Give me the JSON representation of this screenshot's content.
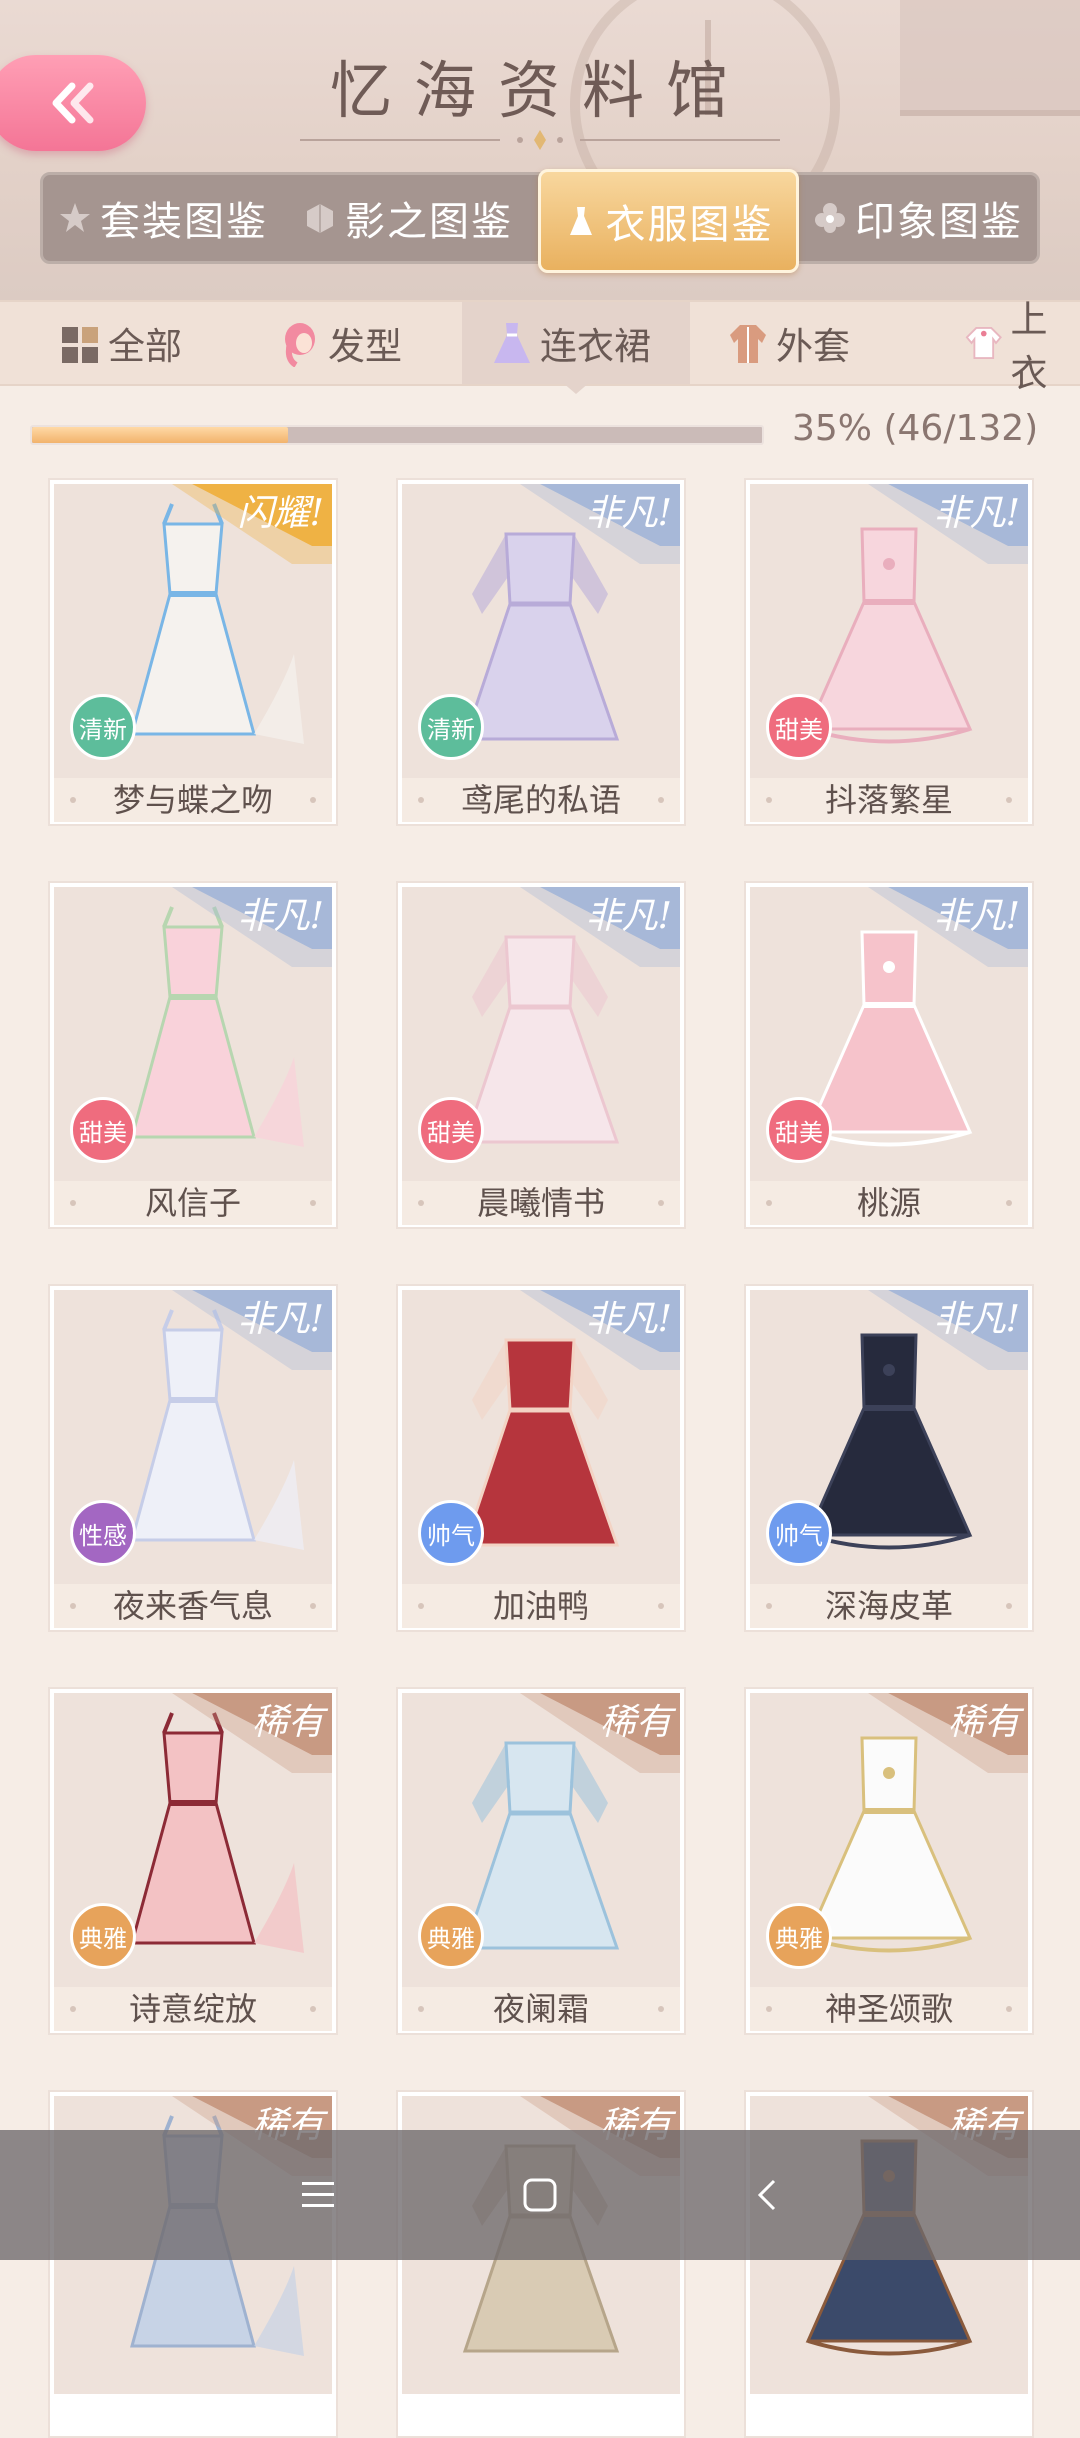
{
  "header": {
    "title": "忆海资料馆",
    "tabs": [
      {
        "label": "套装图鉴",
        "icon": "star-icon"
      },
      {
        "label": "影之图鉴",
        "icon": "cube-icon"
      },
      {
        "label": "衣服图鉴",
        "icon": "dress-icon",
        "active": true
      },
      {
        "label": "印象图鉴",
        "icon": "flower-icon"
      }
    ]
  },
  "categories": [
    {
      "label": "全部",
      "icon": "grid-icon"
    },
    {
      "label": "发型",
      "icon": "hair-icon"
    },
    {
      "label": "连衣裙",
      "icon": "dress-icon",
      "active": true
    },
    {
      "label": "外套",
      "icon": "coat-icon"
    },
    {
      "label": "上衣",
      "icon": "shirt-icon"
    }
  ],
  "progress": {
    "text": "35% (46/132)",
    "fraction": 0.35
  },
  "colors": {
    "shiny": "#f0b34c",
    "extraordinary": "#9fb3d6",
    "rare": "#c99b86",
    "tag_fresh": "#5fbf9d",
    "tag_sweet": "#f0707f",
    "tag_sexy": "#a66bc4",
    "tag_cool": "#6f9ef0",
    "tag_elegant": "#e9a25a"
  },
  "items": [
    {
      "name": "梦与蝶之吻",
      "rarity": "闪耀!",
      "rarity_color": "#efb244",
      "tag": "清新",
      "tag_color": "#5dbd9b",
      "dress_color": "#f5f2ee",
      "accent": "#79b6e6"
    },
    {
      "name": "鸢尾的私语",
      "rarity": "非凡!",
      "rarity_color": "#a7b8d8",
      "tag": "清新",
      "tag_color": "#5dbd9b",
      "dress_color": "#d9d2ec",
      "accent": "#b8abd8"
    },
    {
      "name": "抖落繁星",
      "rarity": "非凡!",
      "rarity_color": "#a7b8d8",
      "tag": "甜美",
      "tag_color": "#ef6c7e",
      "dress_color": "#f7d6dd",
      "accent": "#e9aebd"
    },
    {
      "name": "风信子",
      "rarity": "非凡!",
      "rarity_color": "#a7b8d8",
      "tag": "甜美",
      "tag_color": "#ef6c7e",
      "dress_color": "#f9d2da",
      "accent": "#b7d6b0"
    },
    {
      "name": "晨曦情书",
      "rarity": "非凡!",
      "rarity_color": "#a7b8d8",
      "tag": "甜美",
      "tag_color": "#ef6c7e",
      "dress_color": "#f6e6ea",
      "accent": "#ecc7d0"
    },
    {
      "name": "桃源",
      "rarity": "非凡!",
      "rarity_color": "#a7b8d8",
      "tag": "甜美",
      "tag_color": "#ef6c7e",
      "dress_color": "#f6c3cb",
      "accent": "#ffffff"
    },
    {
      "name": "夜来香气息",
      "rarity": "非凡!",
      "rarity_color": "#a7b8d8",
      "tag": "性感",
      "tag_color": "#a367c2",
      "dress_color": "#eef0f8",
      "accent": "#c6cde8"
    },
    {
      "name": "加油鸭",
      "rarity": "非凡!",
      "rarity_color": "#a7b8d8",
      "tag": "帅气",
      "tag_color": "#6e9bee",
      "dress_color": "#b6353d",
      "accent": "#f3d3c4"
    },
    {
      "name": "深海皮革",
      "rarity": "非凡!",
      "rarity_color": "#a7b8d8",
      "tag": "帅气",
      "tag_color": "#6e9bee",
      "dress_color": "#262a3d",
      "accent": "#3c4159"
    },
    {
      "name": "诗意绽放",
      "rarity": "稀有",
      "rarity_color": "#c89a83",
      "tag": "典雅",
      "tag_color": "#e7a35b",
      "dress_color": "#f3c2c4",
      "accent": "#8c2a36"
    },
    {
      "name": "夜阑霜",
      "rarity": "稀有",
      "rarity_color": "#c89a83",
      "tag": "典雅",
      "tag_color": "#e7a35b",
      "dress_color": "#d7e6f0",
      "accent": "#9cc2dc"
    },
    {
      "name": "神圣颂歌",
      "rarity": "稀有",
      "rarity_color": "#c89a83",
      "tag": "典雅",
      "tag_color": "#e7a35b",
      "dress_color": "#fbfbfb",
      "accent": "#d9c07d"
    },
    {
      "name": "",
      "rarity": "稀有",
      "rarity_color": "#c89a83",
      "tag": "",
      "tag_color": "#e7a35b",
      "dress_color": "#c7d3e6",
      "accent": "#9fb2d0"
    },
    {
      "name": "",
      "rarity": "稀有",
      "rarity_color": "#c89a83",
      "tag": "",
      "tag_color": "#e7a35b",
      "dress_color": "#d9cbb4",
      "accent": "#b6a58a"
    },
    {
      "name": "",
      "rarity": "稀有",
      "rarity_color": "#c89a83",
      "tag": "",
      "tag_color": "#e7a35b",
      "dress_color": "#3b4a6a",
      "accent": "#8a5a3c"
    }
  ],
  "navbar": {
    "menu_icon": "menu-icon",
    "home_icon": "home-icon",
    "back_icon": "back-icon"
  }
}
